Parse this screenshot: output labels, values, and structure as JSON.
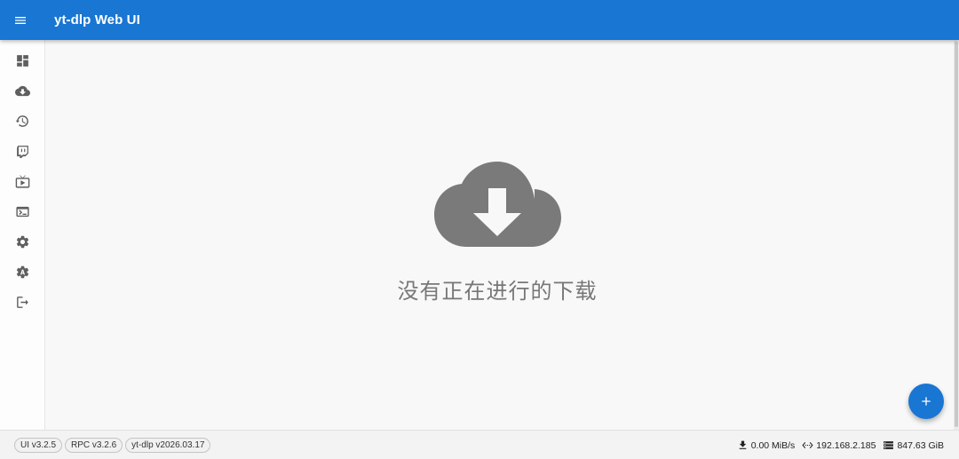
{
  "appbar": {
    "title": "yt-dlp Web UI",
    "menu_icon": "menu-icon",
    "color": "#1976d2"
  },
  "sidebar": {
    "items": [
      {
        "icon": "dashboard-icon"
      },
      {
        "icon": "cloud-download-icon"
      },
      {
        "icon": "history-icon"
      },
      {
        "icon": "twitch-icon"
      },
      {
        "icon": "live-tv-icon"
      },
      {
        "icon": "terminal-icon"
      },
      {
        "icon": "settings-icon"
      },
      {
        "icon": "settings-auto-icon"
      },
      {
        "icon": "logout-icon"
      }
    ]
  },
  "main": {
    "empty_icon": "cloud-download-icon",
    "empty_text": "没有正在进行的下载"
  },
  "fab": {
    "icon": "add-icon"
  },
  "footer": {
    "versions": [
      "UI v3.2.5",
      "RPC v3.2.6",
      "yt-dlp v2026.03.17"
    ],
    "speed": "0.00 MiB/s",
    "address": "192.168.2.185",
    "storage": "847.63 GiB"
  }
}
